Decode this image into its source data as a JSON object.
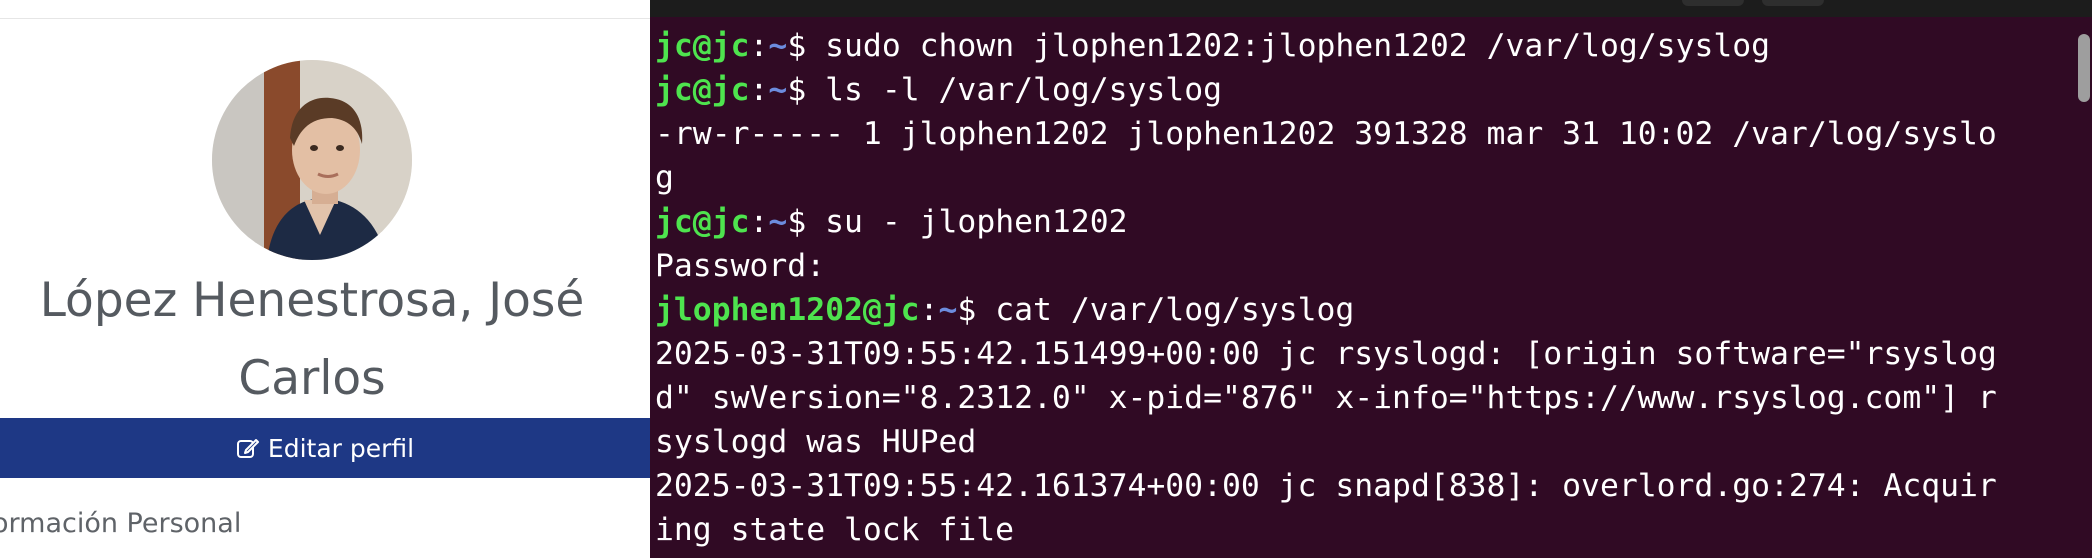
{
  "profile": {
    "name": "López Henestrosa, José Carlos",
    "name_line1": "López Henestrosa, José",
    "name_line2": "Carlos",
    "edit_button_label": "Editar perfil",
    "section_label": "ormación Personal",
    "avatar_description": "profile-photo"
  },
  "terminal": {
    "colors": {
      "background": "#300a24",
      "prompt_user": "#4ee44e",
      "prompt_path": "#6c8cde",
      "text": "#ffffff"
    },
    "lines": [
      {
        "type": "prompt",
        "user": "jc@jc",
        "sep": ":",
        "path": "~",
        "symbol": "$ ",
        "command": "sudo chown jlophen1202:jlophen1202 /var/log/syslog"
      },
      {
        "type": "prompt",
        "user": "jc@jc",
        "sep": ":",
        "path": "~",
        "symbol": "$ ",
        "command": "ls -l /var/log/syslog"
      },
      {
        "type": "output",
        "text": "-rw-r----- 1 jlophen1202 jlophen1202 391328 mar 31 10:02 /var/log/syslo"
      },
      {
        "type": "output",
        "text": "g"
      },
      {
        "type": "prompt",
        "user": "jc@jc",
        "sep": ":",
        "path": "~",
        "symbol": "$ ",
        "command": "su - jlophen1202"
      },
      {
        "type": "output",
        "text": "Password:"
      },
      {
        "type": "prompt",
        "user": "jlophen1202@jc",
        "sep": ":",
        "path": "~",
        "symbol": "$ ",
        "command": "cat /var/log/syslog"
      },
      {
        "type": "output",
        "text": "2025-03-31T09:55:42.151499+00:00 jc rsyslogd: [origin software=\"rsyslog"
      },
      {
        "type": "output",
        "text": "d\" swVersion=\"8.2312.0\" x-pid=\"876\" x-info=\"https://www.rsyslog.com\"] r"
      },
      {
        "type": "output",
        "text": "syslogd was HUPed"
      },
      {
        "type": "output",
        "text": "2025-03-31T09:55:42.161374+00:00 jc snapd[838]: overlord.go:274: Acquir"
      },
      {
        "type": "output",
        "text": "ing state lock file"
      }
    ]
  }
}
